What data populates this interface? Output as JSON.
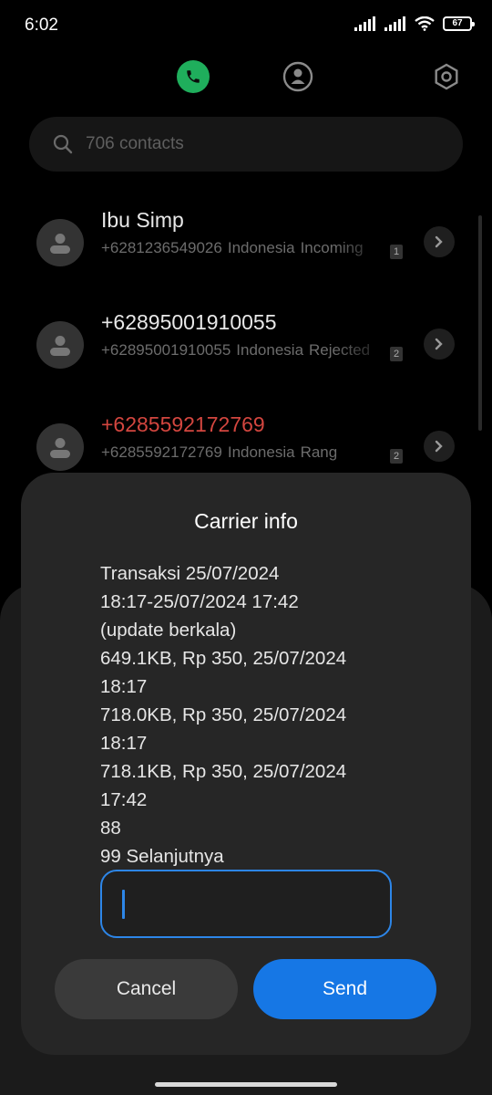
{
  "status_bar": {
    "time": "6:02",
    "battery_level": "67"
  },
  "search": {
    "placeholder": "706 contacts"
  },
  "calls": [
    {
      "name": "Ibu Simp",
      "number": "+6281236549026",
      "location": "Indonesia",
      "status": "Incoming",
      "sim": "1",
      "missed": false
    },
    {
      "name": "+62895001910055",
      "number": "+62895001910055",
      "location": "Indonesia",
      "status": "Rejected",
      "sim": "2",
      "missed": false
    },
    {
      "name": "+6285592172769",
      "number": "+6285592172769",
      "location": "Indonesia",
      "status": "Rang",
      "sim": "2",
      "missed": true
    }
  ],
  "dialog": {
    "title": "Carrier info",
    "lines": [
      "Transaksi 25/07/2024",
      "18:17-25/07/2024 17:42",
      "(update berkala)",
      "649.1KB, Rp 350, 25/07/2024",
      "18:17",
      "718.0KB, Rp 350, 25/07/2024",
      "18:17",
      "718.1KB, Rp 350, 25/07/2024",
      "17:42",
      "88",
      "99 Selanjutnya"
    ],
    "input_value": "",
    "cancel_label": "Cancel",
    "send_label": "Send"
  },
  "colors": {
    "accent": "#1677e5",
    "phone_tab": "#1fae5c",
    "missed": "#d3463f",
    "focus": "#2d86e8"
  }
}
